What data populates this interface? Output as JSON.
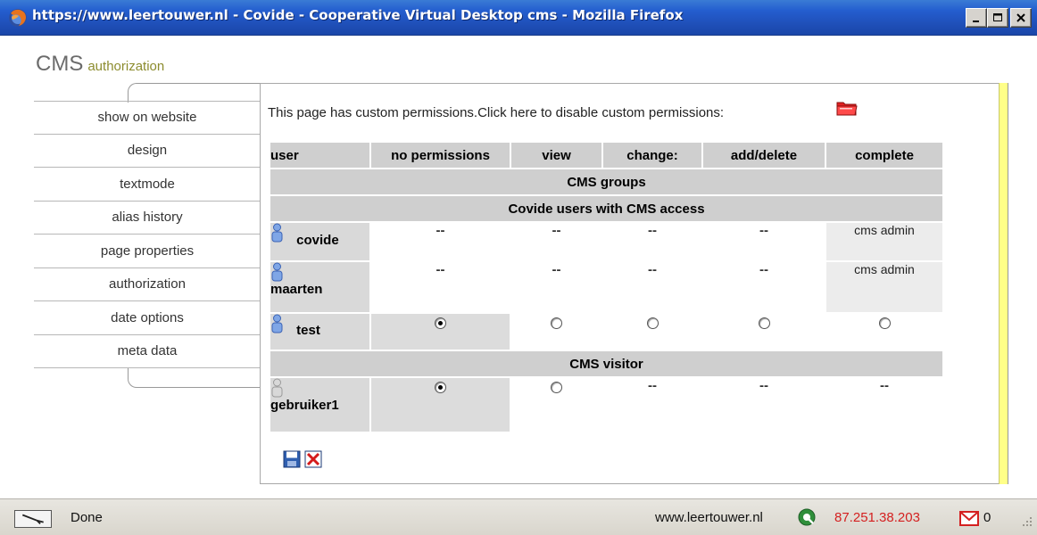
{
  "window": {
    "title": "https://www.leertouwer.nl - Covide - Cooperative Virtual Desktop cms - Mozilla Firefox",
    "minimize": "_",
    "maximize": "□",
    "close": "×"
  },
  "heading": {
    "title": "CMS",
    "subtitle": "authorization"
  },
  "menu": {
    "items": [
      {
        "label": "show on website"
      },
      {
        "label": "design"
      },
      {
        "label": "textmode"
      },
      {
        "label": "alias history"
      },
      {
        "label": "page properties"
      },
      {
        "label": "authorization"
      },
      {
        "label": "date options"
      },
      {
        "label": "meta data"
      }
    ]
  },
  "content": {
    "notice": "This page has custom permissions.Click here to disable custom permissions:",
    "icons": {
      "folder": "folder-icon",
      "save": "save-icon",
      "cancel": "cancel-icon"
    }
  },
  "table": {
    "headers": [
      "user",
      "no permissions",
      "view",
      "change:",
      "add/delete",
      "complete"
    ],
    "groups": {
      "cms_groups": "CMS groups",
      "covide_users": "Covide users with CMS access",
      "cms_visitor": "CMS visitor"
    },
    "rows": [
      {
        "user": "covide",
        "cells": [
          "--",
          "--",
          "--",
          "--",
          "cms admin"
        ]
      },
      {
        "user": "maarten",
        "cells": [
          "--",
          "--",
          "--",
          "--",
          "cms admin"
        ]
      },
      {
        "user": "test",
        "selected": "no permissions"
      },
      {
        "user": "gebruiker1",
        "selected": "no permissions",
        "cells": [
          "",
          "",
          "--",
          "--",
          "--"
        ]
      }
    ]
  },
  "status": {
    "text": "Done",
    "host": "www.leertouwer.nl",
    "ip": "87.251.38.203",
    "mail_count": "0"
  },
  "colors": {
    "titlebar": "#245ecf",
    "table_header": "#cfcfcf",
    "ip_text": "#d42020",
    "side_bar": "#ffff88",
    "heading_sub": "#8c8c2e"
  }
}
